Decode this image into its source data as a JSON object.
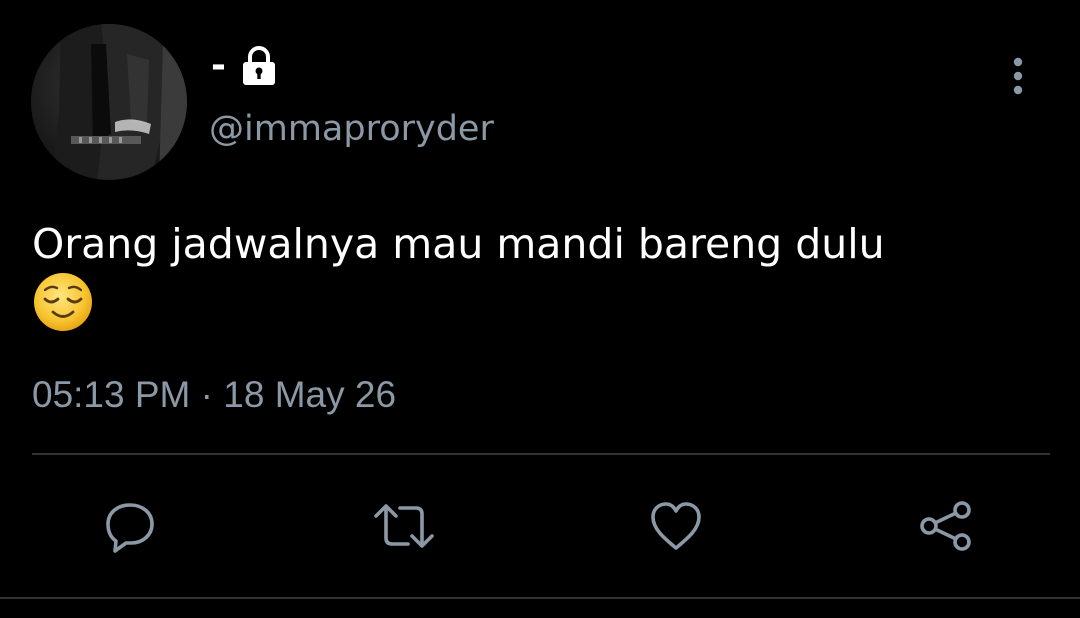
{
  "author": {
    "display_name": "-",
    "handle": "@immaproryder",
    "protected_icon": "lock-icon",
    "avatar": "user-avatar"
  },
  "tweet": {
    "text": "Orang jadwalnya mau mandi bareng dulu",
    "emoji": "😌",
    "time": "05:13 PM",
    "separator": "·",
    "date": "18 May 26"
  },
  "actions": [
    {
      "name": "reply",
      "icon": "comment-icon"
    },
    {
      "name": "retweet",
      "icon": "retweet-icon"
    },
    {
      "name": "like",
      "icon": "heart-icon"
    },
    {
      "name": "share",
      "icon": "share-icon"
    }
  ],
  "menu": {
    "icon": "more-vertical-icon"
  },
  "colors": {
    "background": "#000000",
    "text": "#ffffff",
    "secondary_text": "#8b98a5",
    "divider": "#2f3336",
    "icon": "#8b98a5"
  }
}
